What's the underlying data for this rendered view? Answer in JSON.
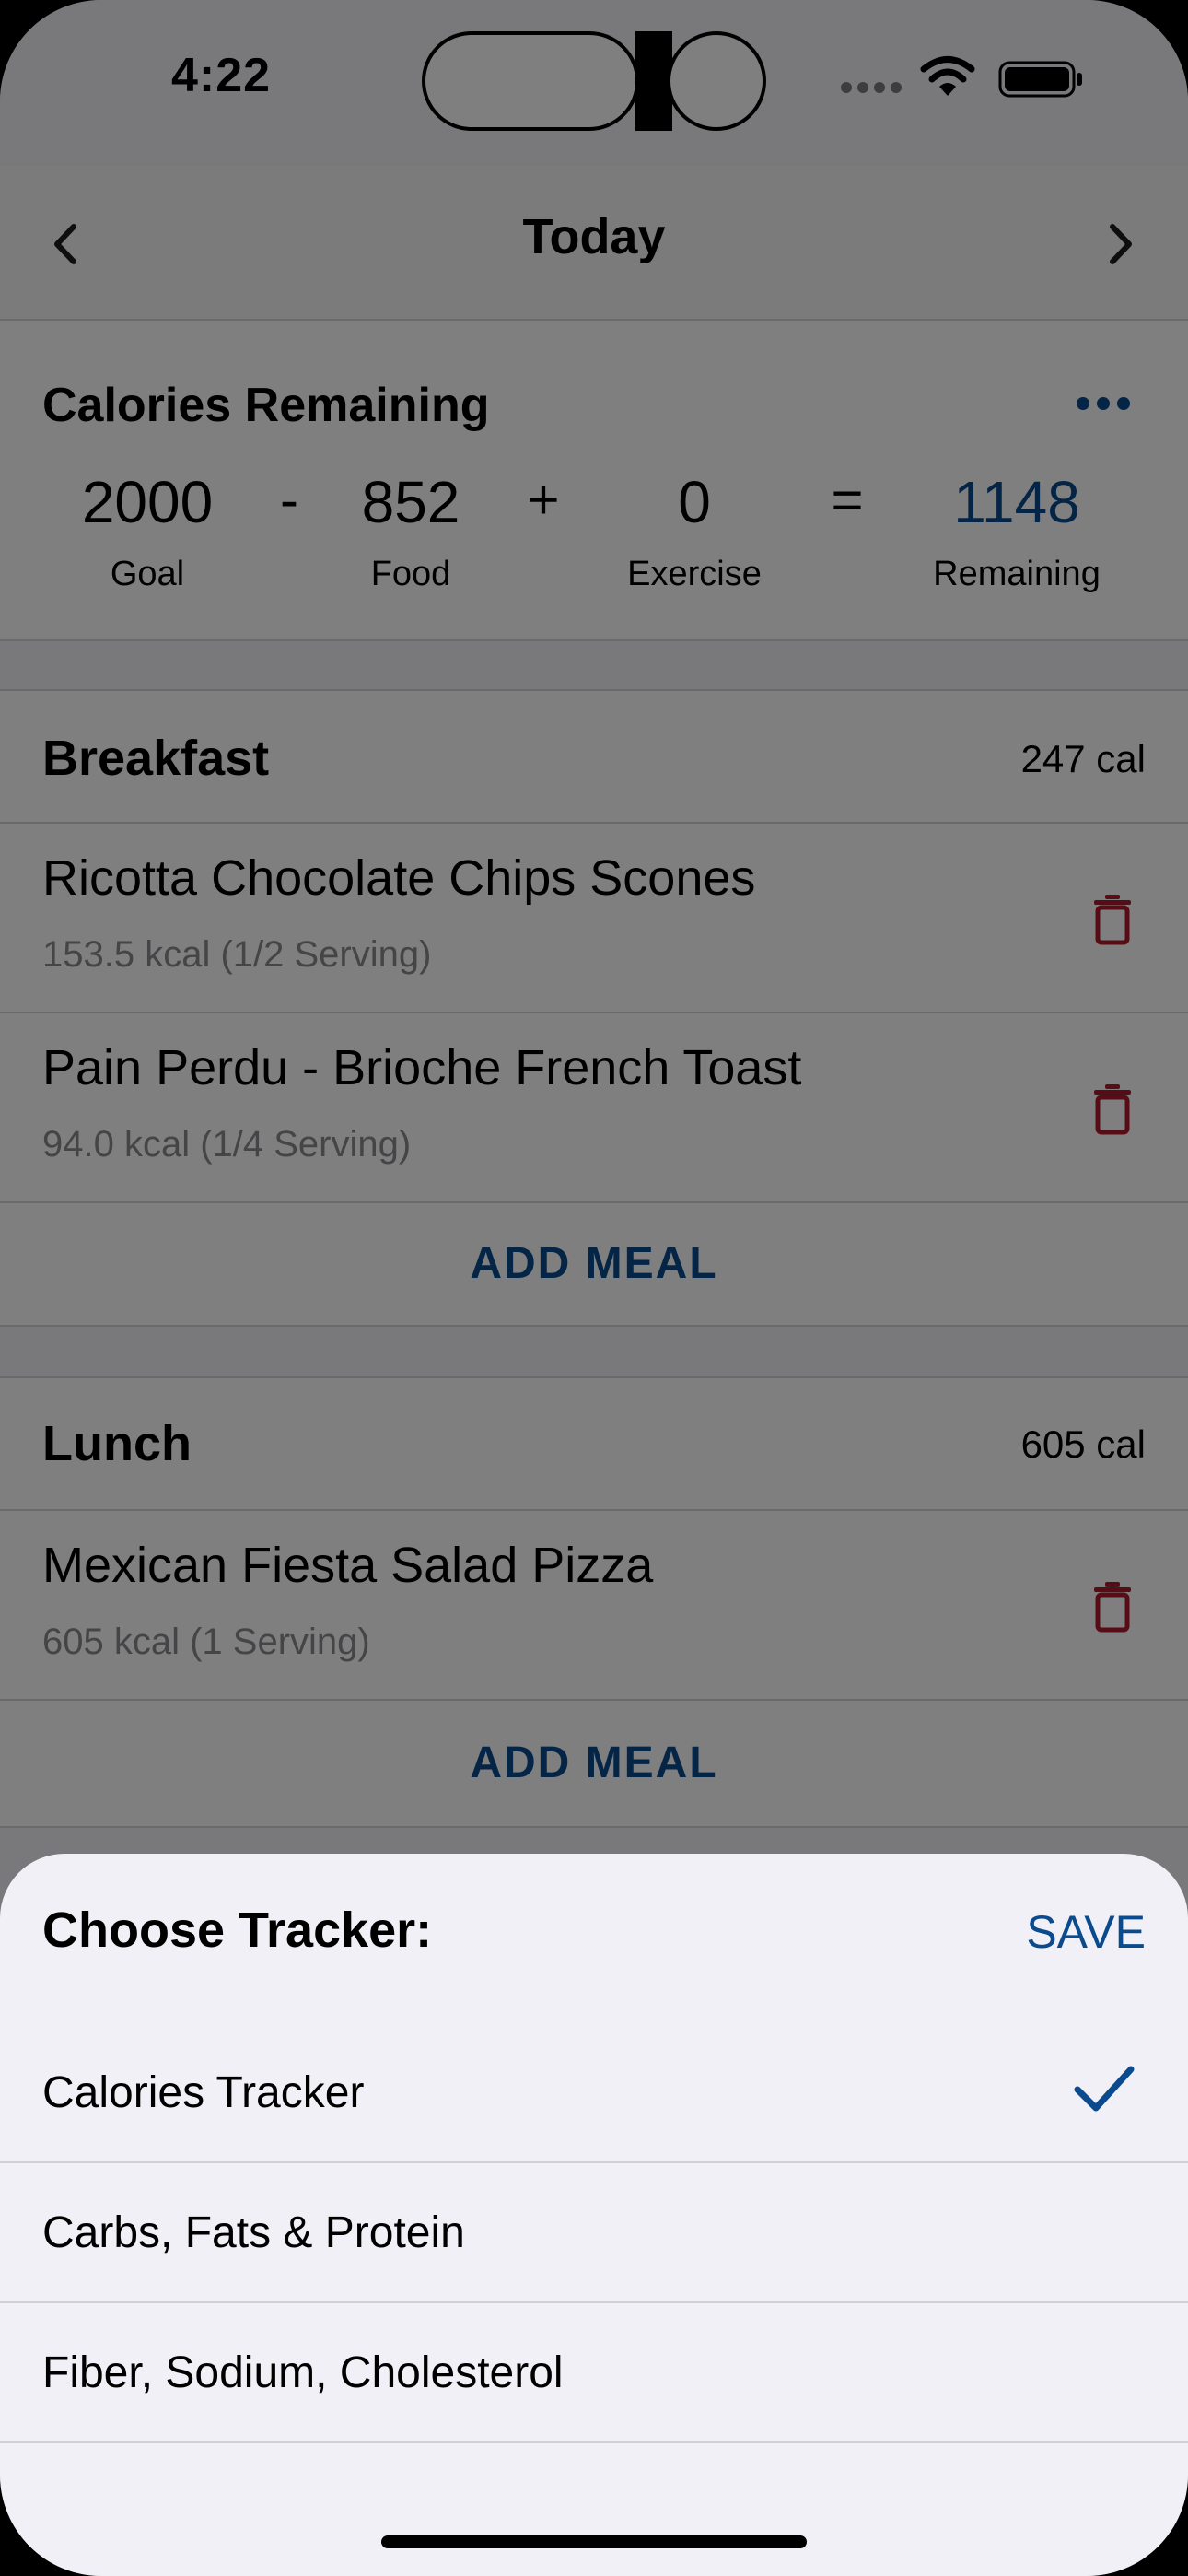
{
  "status_bar": {
    "time": "4:22"
  },
  "nav": {
    "title": "Today"
  },
  "summary": {
    "title": "Calories Remaining",
    "goal": "2000",
    "goal_label": "Goal",
    "minus": "-",
    "food": "852",
    "food_label": "Food",
    "plus": "+",
    "exercise": "0",
    "exercise_label": "Exercise",
    "equals": "=",
    "remaining": "1148",
    "remaining_label": "Remaining"
  },
  "meals": [
    {
      "name": "Breakfast",
      "calories": "247 cal",
      "items": [
        {
          "name": "Ricotta Chocolate Chips Scones",
          "detail": "153.5 kcal (1/2 Serving)"
        },
        {
          "name": "Pain Perdu - Brioche French Toast",
          "detail": "94.0 kcal (1/4 Serving)"
        }
      ],
      "add_label": "ADD MEAL"
    },
    {
      "name": "Lunch",
      "calories": "605 cal",
      "items": [
        {
          "name": "Mexican Fiesta Salad Pizza",
          "detail": "605 kcal (1 Serving)"
        }
      ],
      "add_label": "ADD MEAL"
    }
  ],
  "sheet": {
    "title": "Choose Tracker:",
    "save_label": "SAVE",
    "options": [
      {
        "label": "Calories Tracker",
        "selected": true
      },
      {
        "label": "Carbs, Fats & Protein",
        "selected": false
      },
      {
        "label": "Fiber, Sodium, Cholesterol",
        "selected": false
      }
    ]
  },
  "icons": {
    "nav_prev": "chevron-left-icon",
    "nav_next": "chevron-right-icon",
    "more": "ellipsis-icon",
    "delete": "trash-icon",
    "selected": "checkmark-icon"
  },
  "colors": {
    "accent": "#0b4a8c",
    "delete": "#b0192a",
    "sheet_bg": "#f0f0f6"
  }
}
